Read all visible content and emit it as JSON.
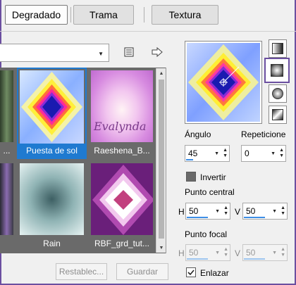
{
  "tabs": [
    {
      "label": "Degradado",
      "active": true
    },
    {
      "label": "Trama",
      "active": false
    },
    {
      "label": "Textura",
      "active": false
    }
  ],
  "library": {
    "selected": ""
  },
  "gallery": {
    "items": [
      {
        "caption": "...",
        "selected": false
      },
      {
        "caption": "Puesta de sol",
        "selected": true
      },
      {
        "caption": "Raeshena_B...",
        "selected": false
      },
      {
        "caption": "",
        "selected": false
      },
      {
        "caption": "Rain",
        "selected": false
      },
      {
        "caption": "RBF_grd_tut...",
        "selected": false
      }
    ],
    "watermark_text": "Evalynda"
  },
  "buttons": {
    "reset": "Restablec...",
    "save": "Guardar"
  },
  "controls": {
    "angle_label": "Ángulo",
    "angle_value": "45",
    "repeats_label": "Repeticione",
    "repeats_value": "0",
    "invert_label": "Invertir",
    "invert_checked": false,
    "center_label": "Punto central",
    "center_h_label": "H",
    "center_h": "50",
    "center_v_label": "V",
    "center_v": "50",
    "focal_label": "Punto focal",
    "focal_h_label": "H",
    "focal_h": "50",
    "focal_v_label": "V",
    "focal_v": "50",
    "link_label": "Enlazar",
    "link_checked": true
  },
  "styles": [
    "linear-style-icon",
    "rectangular-style-icon",
    "sunburst-style-icon",
    "radial-style-icon"
  ],
  "colors": {
    "accent": "#1f7ad0",
    "frame": "#6b4fa0",
    "gallery_bg": "#6a6a6a"
  }
}
